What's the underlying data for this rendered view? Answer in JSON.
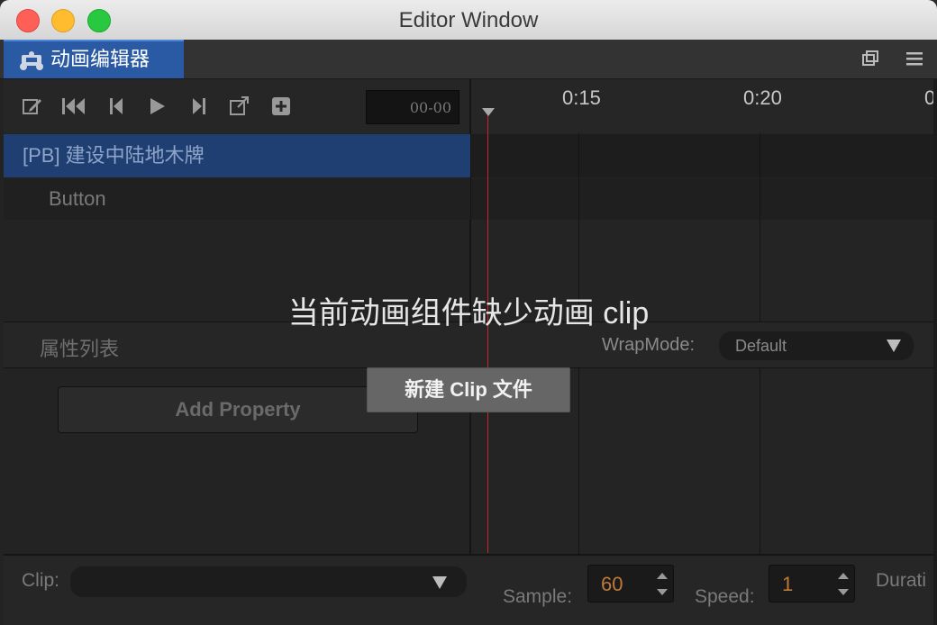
{
  "window": {
    "title": "Editor Window"
  },
  "tab": {
    "label": "动画编辑器"
  },
  "toolbar": {
    "time_value": "00-00",
    "icons": [
      "edit-icon",
      "skip-first-icon",
      "step-back-icon",
      "play-icon",
      "step-forward-icon",
      "export-icon",
      "add-event-icon"
    ]
  },
  "ruler": {
    "labels": [
      "0:15",
      "0:20",
      "0"
    ]
  },
  "tree": {
    "root_label": "[PB] 建设中陆地木牌",
    "child_label": "Button"
  },
  "properties": {
    "title": "属性列表",
    "wrap_label": "WrapMode:",
    "wrap_value": "Default",
    "add_property_label": "Add Property"
  },
  "overlay": {
    "message": "当前动画组件缺少动画 clip",
    "new_clip_label": "新建 Clip 文件"
  },
  "bottom": {
    "clip_label": "Clip:",
    "clip_value": "",
    "sample_label": "Sample:",
    "sample_value": "60",
    "speed_label": "Speed:",
    "speed_value": "1",
    "duration_label": "Durati"
  },
  "colors": {
    "tab_active": "#2a5aa3",
    "selected_row": "#1f3f73",
    "playhead": "#c8282a",
    "number_value": "#c07a38"
  }
}
